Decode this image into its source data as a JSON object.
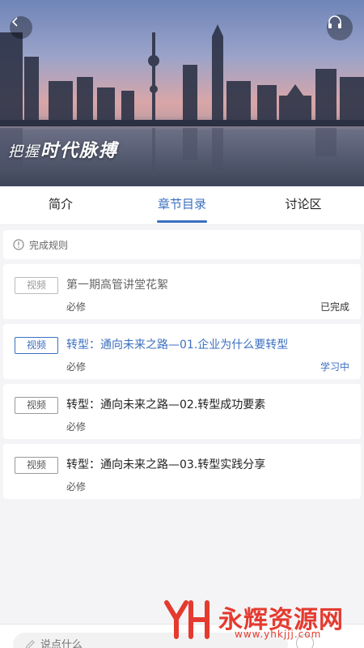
{
  "hero": {
    "slogan_prefix": "把握",
    "slogan_main": "时代脉搏"
  },
  "tabs": [
    {
      "label": "简介",
      "active": false
    },
    {
      "label": "章节目录",
      "active": true
    },
    {
      "label": "讨论区",
      "active": false
    }
  ],
  "rules": {
    "label": "完成规则"
  },
  "lessons": [
    {
      "badge": "视频",
      "title": "第一期高管讲堂花絮",
      "requirement": "必修",
      "status": "已完成"
    },
    {
      "badge": "视频",
      "title": "转型：通向未来之路—01.企业为什么要转型",
      "requirement": "必修",
      "status": "学习中"
    },
    {
      "badge": "视频",
      "title": "转型：通向未来之路—02.转型成功要素",
      "requirement": "必修",
      "status": ""
    },
    {
      "badge": "视频",
      "title": "转型：通向未来之路—03.转型实践分享",
      "requirement": "必修",
      "status": ""
    }
  ],
  "comment": {
    "placeholder": "说点什么"
  },
  "watermark": {
    "brand": "永辉资源网",
    "url": "www.yhkjjj.com"
  },
  "colors": {
    "accent": "#3b6fc0",
    "watermark": "#e53a2f"
  },
  "icons": [
    "back-arrow-icon",
    "headphones-icon",
    "info-circle-icon",
    "edit-icon",
    "smiley-icon"
  ]
}
